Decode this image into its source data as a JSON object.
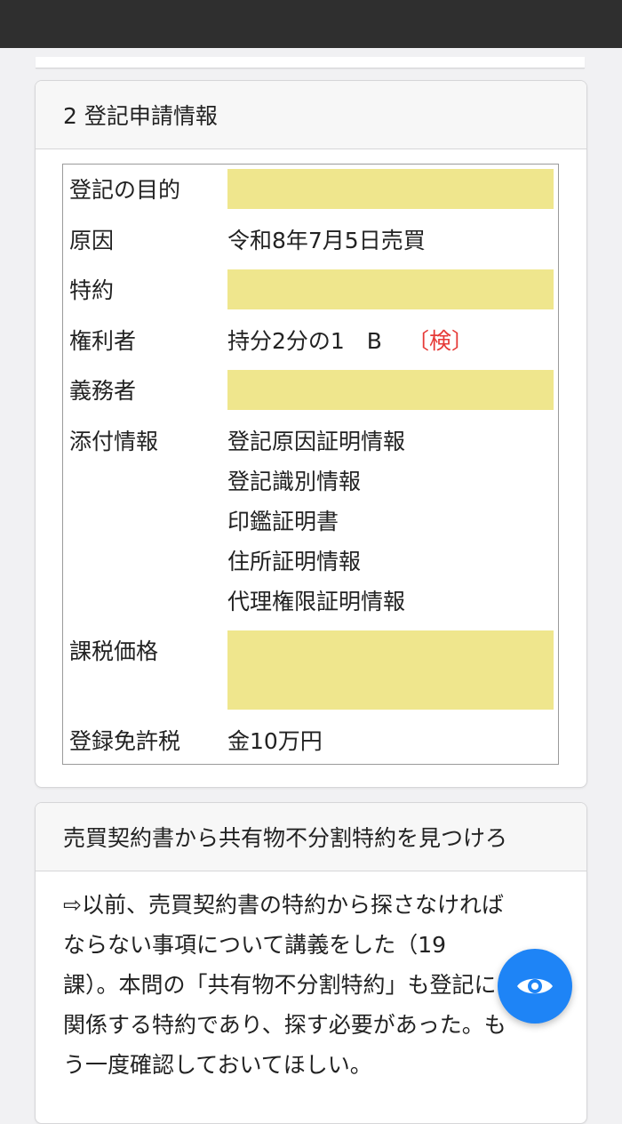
{
  "section": {
    "title": "2 登記申請情報",
    "rows": {
      "purpose_label": "登記の目的",
      "cause_label": "原因",
      "cause_value": "令和8年7月5日売買",
      "special_label": "特約",
      "right_holder_label": "権利者",
      "right_holder_value": "持分2分の1　B",
      "right_holder_mark": "〔検〕",
      "obligor_label": "義務者",
      "attach_label": "添付情報",
      "attachments": [
        "登記原因証明情報",
        "登記識別情報",
        "印鑑証明書",
        "住所証明情報",
        "代理権限証明情報"
      ],
      "tax_base_label": "課税価格",
      "license_tax_label": "登録免許税",
      "license_tax_value": "金10万円"
    }
  },
  "note": {
    "title": "売買契約書から共有物不分割特約を見つけろ",
    "lines": [
      "⇨以前、売買契約書の特約から探さなければ",
      "ならない事項について講義をした（19",
      "課）。本問の「共有物不分割特約」も登記に",
      "関係する特約であり、探す必要があった。も",
      "う一度確認しておいてほしい。"
    ]
  },
  "fab": {
    "icon": "eye-icon"
  },
  "colors": {
    "highlight": "#efe68d",
    "fab": "#1e84f6",
    "mark": "#e63a37",
    "topbar": "#2f2f2f"
  }
}
